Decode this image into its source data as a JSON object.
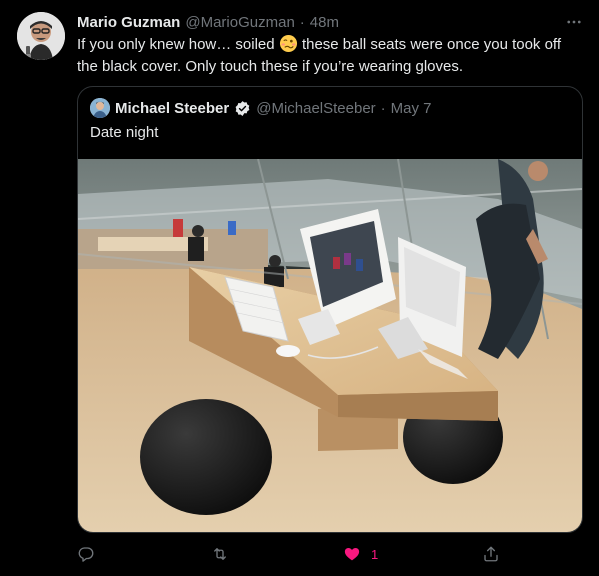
{
  "tweet": {
    "author_name": "Mario Guzman",
    "author_handle": "@MarioGuzman",
    "separator": "·",
    "time": "48m",
    "text_before_emoji": "If you only knew how… soiled ",
    "emoji": "woozy-face",
    "text_after_emoji": " these ball seats were once you took off the black cover. Only touch these if you’re wearing gloves."
  },
  "quoted": {
    "author_name": "Michael Steeber",
    "verified": true,
    "author_handle": "@MichaelSteeber",
    "separator": "·",
    "date": "May 7",
    "text": "Date night",
    "image": "photo of an Apple Store table with two computers resting on black ball seats"
  },
  "actions": {
    "reply_icon": "reply-icon",
    "retweet_icon": "retweet-icon",
    "like_icon": "heart-filled-icon",
    "like_count": "1",
    "share_icon": "share-icon"
  },
  "colors": {
    "background": "#000000",
    "text_primary": "#e7e9ea",
    "text_secondary": "#71767b",
    "border": "#2f3336",
    "like": "#f91880",
    "verified": "#e7e9ea"
  }
}
